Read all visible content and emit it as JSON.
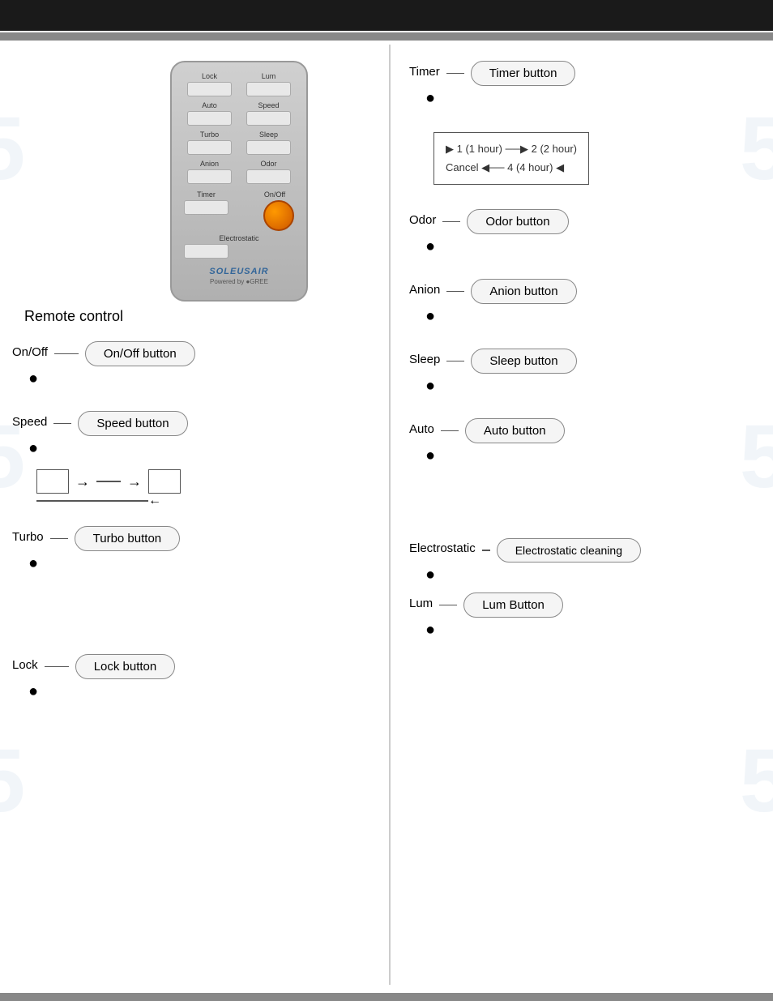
{
  "topBar": {
    "label": ""
  },
  "remoteControl": {
    "label": "Remote control",
    "buttons": [
      {
        "row_label_left": "Lock",
        "row_label_right": "Lum"
      },
      {
        "row_label_left": "Auto",
        "row_label_right": "Speed"
      },
      {
        "row_label_left": "Turbo",
        "row_label_right": "Sleep"
      },
      {
        "row_label_left": "Anion",
        "row_label_right": "Odor"
      },
      {
        "row_label_left": "Timer",
        "row_label_right": ""
      },
      {
        "row_label_left": "Electrostatic",
        "row_label_right": ""
      }
    ],
    "onoff_label": "On/Off",
    "logo": "SOLEUSAIR",
    "powered_by": "Powered by GREE"
  },
  "left": {
    "onoff": {
      "label": "On/Off",
      "button_text": "On/Off  button",
      "bullet": "●"
    },
    "speed": {
      "label": "Speed",
      "button_text": "Speed button",
      "bullet": "●"
    },
    "turbo": {
      "label": "Turbo",
      "button_text": "Turbo button",
      "bullet": "●"
    },
    "lock": {
      "label": "Lock",
      "button_text": "Lock button",
      "bullet": "●"
    }
  },
  "right": {
    "timer": {
      "label": "Timer",
      "button_text": "Timer button",
      "bullet": "●",
      "diagram": {
        "line1": "▶ 1 (1 hour) ──▶ 2 (2 hour)",
        "line2": "Cancel ◀── 4 (4 hour) ◀"
      }
    },
    "odor": {
      "label": "Odor",
      "button_text": "Odor button",
      "bullet": "●"
    },
    "anion": {
      "label": "Anion",
      "button_text": "Anion button",
      "bullet": "●"
    },
    "sleep": {
      "label": "Sleep",
      "button_text": "Sleep button",
      "bullet": "●"
    },
    "auto": {
      "label": "Auto",
      "button_text": "Auto button",
      "bullet": "●"
    },
    "electrostatic": {
      "label": "Electrostatic",
      "button_text": "Electrostatic cleaning",
      "bullet": "●"
    },
    "lum": {
      "label": "Lum",
      "button_text": "Lum Button",
      "bullet": "●"
    }
  }
}
